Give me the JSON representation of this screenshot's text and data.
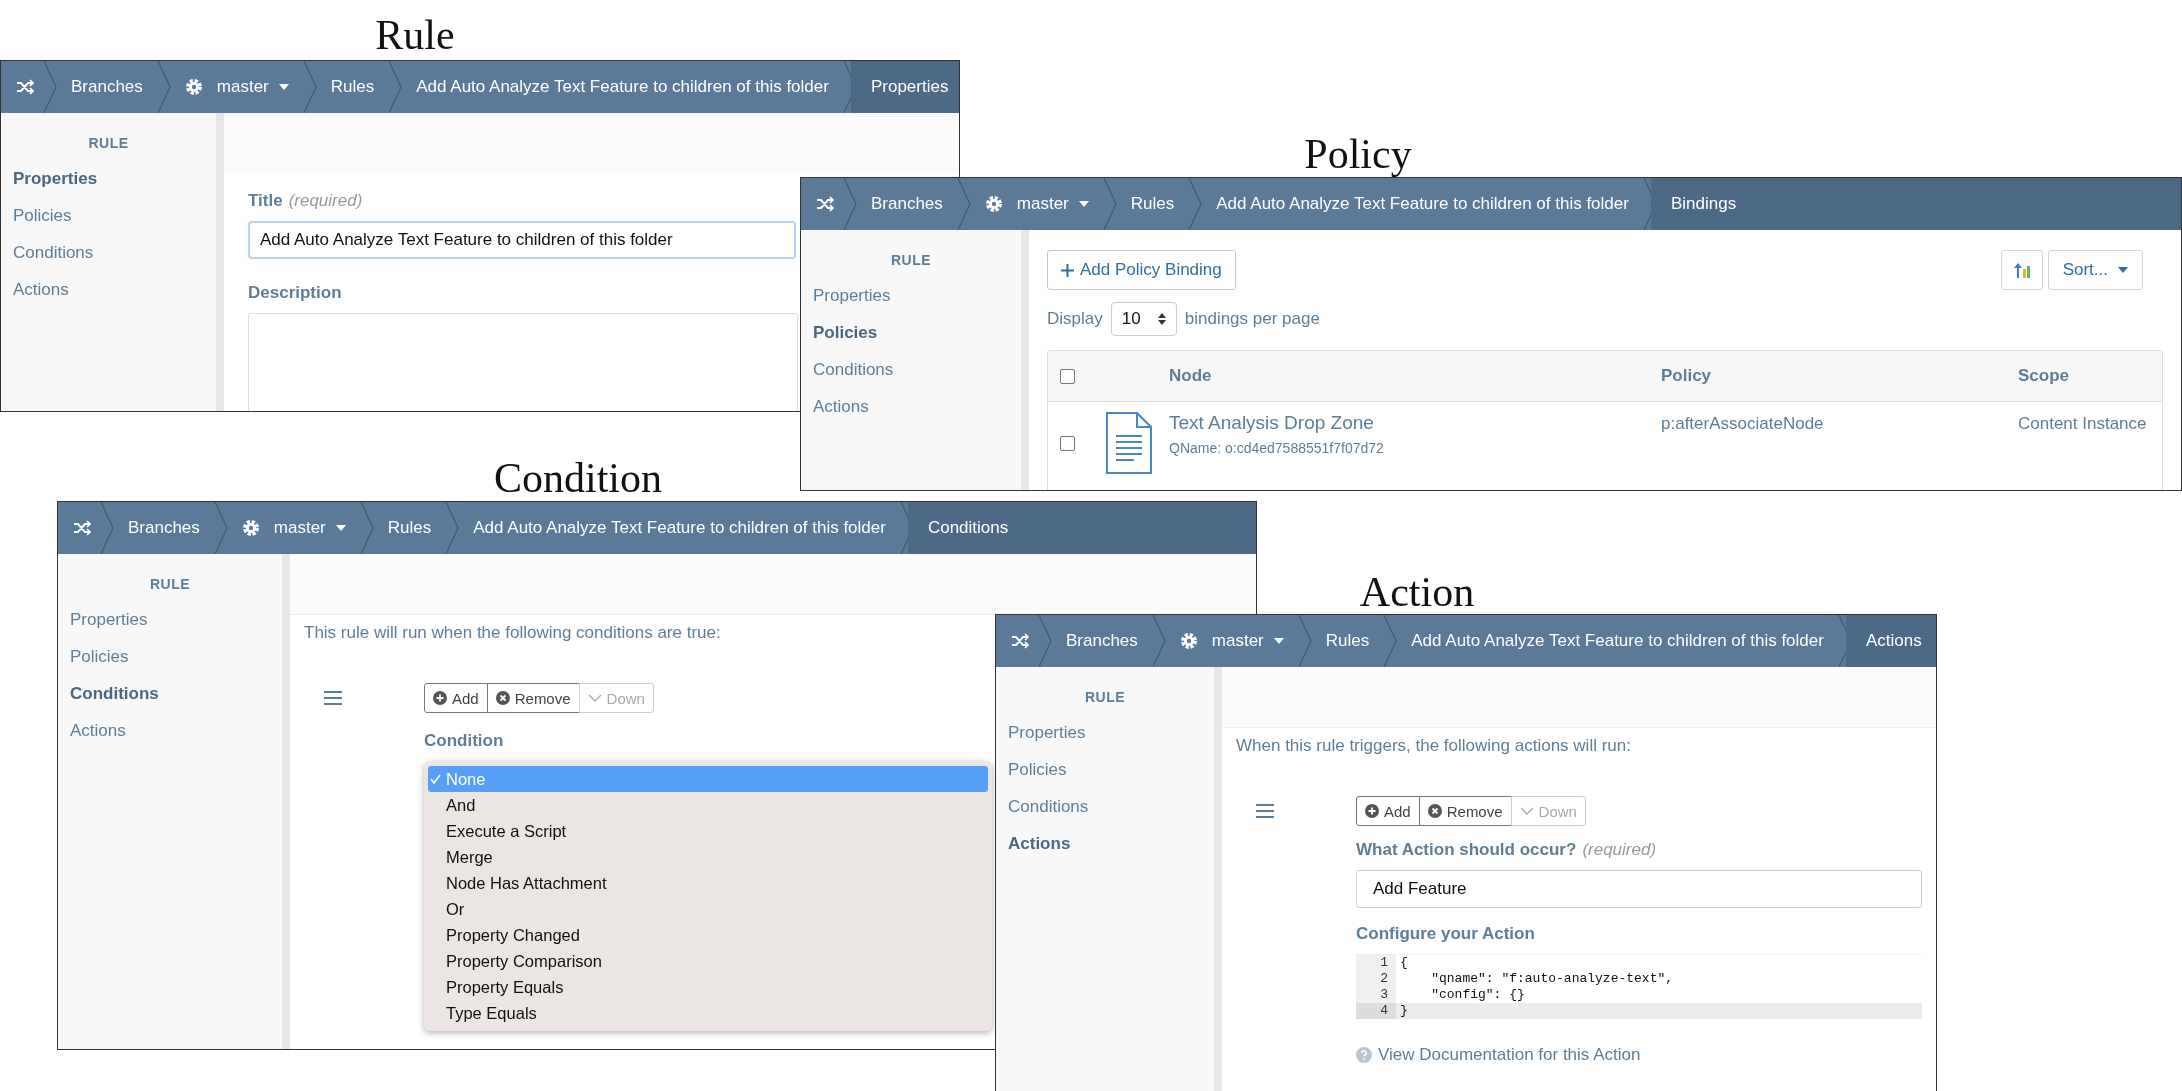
{
  "panels": [
    {
      "kind": "properties",
      "caption": "Rule",
      "breadcrumb": [
        {
          "kind": "home",
          "current": false
        },
        {
          "kind": "link",
          "label": "Branches",
          "current": false
        },
        {
          "kind": "branch",
          "label": "master",
          "current": false
        },
        {
          "kind": "link",
          "label": "Rules",
          "current": false
        },
        {
          "kind": "link",
          "label": "Add Auto Analyze Text Feature to children of this folder",
          "current": false
        },
        {
          "kind": "link",
          "label": "Properties",
          "current": true
        }
      ],
      "sidebar": {
        "heading": "RULE",
        "items": [
          {
            "label": "Properties",
            "selected": true
          },
          {
            "label": "Policies",
            "selected": false
          },
          {
            "label": "Conditions",
            "selected": false
          },
          {
            "label": "Actions",
            "selected": false
          }
        ]
      },
      "title_field": {
        "label": "Title",
        "hint": "(required)",
        "value": "Add Auto Analyze Text Feature to children of this folder"
      },
      "description_field": {
        "label": "Description"
      }
    },
    {
      "kind": "bindings",
      "caption": "Policy",
      "breadcrumb": [
        {
          "kind": "home",
          "current": false
        },
        {
          "kind": "link",
          "label": "Branches",
          "current": false
        },
        {
          "kind": "branch",
          "label": "master",
          "current": false
        },
        {
          "kind": "link",
          "label": "Rules",
          "current": false
        },
        {
          "kind": "link",
          "label": "Add Auto Analyze Text Feature to children of this folder",
          "current": false
        },
        {
          "kind": "link",
          "label": "Bindings",
          "current": true
        }
      ],
      "sidebar": {
        "heading": "RULE",
        "items": [
          {
            "label": "Properties",
            "selected": false
          },
          {
            "label": "Policies",
            "selected": true
          },
          {
            "label": "Conditions",
            "selected": false
          },
          {
            "label": "Actions",
            "selected": false
          }
        ]
      },
      "add_button": "Add Policy Binding",
      "sort_button": "Sort...",
      "page_size": {
        "before": "Display",
        "value": "10",
        "after": "bindings per page"
      },
      "table": {
        "columns": [
          "Node",
          "Policy",
          "Scope"
        ],
        "all_checked": false,
        "rows": [
          {
            "checked": false,
            "node": "Text Analysis Drop Zone",
            "qname": "QName: o:cd4ed7588551f7f07d72",
            "policy": "p:afterAssociateNode",
            "scope": "Content Instance"
          }
        ]
      }
    },
    {
      "kind": "conditions",
      "caption": "Condition",
      "breadcrumb": [
        {
          "kind": "home",
          "current": false
        },
        {
          "kind": "link",
          "label": "Branches",
          "current": false
        },
        {
          "kind": "branch",
          "label": "master",
          "current": false
        },
        {
          "kind": "link",
          "label": "Rules",
          "current": false
        },
        {
          "kind": "link",
          "label": "Add Auto Analyze Text Feature to children of this folder",
          "current": false
        },
        {
          "kind": "link",
          "label": "Conditions",
          "current": true
        }
      ],
      "sidebar": {
        "heading": "RULE",
        "items": [
          {
            "label": "Properties",
            "selected": false
          },
          {
            "label": "Policies",
            "selected": false
          },
          {
            "label": "Conditions",
            "selected": true
          },
          {
            "label": "Actions",
            "selected": false
          }
        ]
      },
      "intro": "This rule will run when the following conditions are true:",
      "toolbar": [
        {
          "kind": "add",
          "label": "Add",
          "disabled": false
        },
        {
          "kind": "remove",
          "label": "Remove",
          "disabled": false
        },
        {
          "kind": "down",
          "label": "Down",
          "disabled": true
        }
      ],
      "field_label": "Condition",
      "options": [
        {
          "label": "None",
          "selected": true
        },
        {
          "label": "And",
          "selected": false
        },
        {
          "label": "Execute a Script",
          "selected": false
        },
        {
          "label": "Merge",
          "selected": false
        },
        {
          "label": "Node Has Attachment",
          "selected": false
        },
        {
          "label": "Or",
          "selected": false
        },
        {
          "label": "Property Changed",
          "selected": false
        },
        {
          "label": "Property Comparison",
          "selected": false
        },
        {
          "label": "Property Equals",
          "selected": false
        },
        {
          "label": "Type Equals",
          "selected": false
        }
      ]
    },
    {
      "kind": "actions",
      "caption": "Action",
      "breadcrumb": [
        {
          "kind": "home",
          "current": false
        },
        {
          "kind": "link",
          "label": "Branches",
          "current": false
        },
        {
          "kind": "branch",
          "label": "master",
          "current": false
        },
        {
          "kind": "link",
          "label": "Rules",
          "current": false
        },
        {
          "kind": "link",
          "label": "Add Auto Analyze Text Feature to children of this folder",
          "current": false
        },
        {
          "kind": "link",
          "label": "Actions",
          "current": true
        }
      ],
      "sidebar": {
        "heading": "RULE",
        "items": [
          {
            "label": "Properties",
            "selected": false
          },
          {
            "label": "Policies",
            "selected": false
          },
          {
            "label": "Conditions",
            "selected": false
          },
          {
            "label": "Actions",
            "selected": true
          }
        ]
      },
      "intro": "When this rule triggers, the following actions will run:",
      "toolbar": [
        {
          "kind": "add",
          "label": "Add",
          "disabled": false
        },
        {
          "kind": "remove",
          "label": "Remove",
          "disabled": false
        },
        {
          "kind": "down",
          "label": "Down",
          "disabled": true
        }
      ],
      "action_field": {
        "label": "What Action should occur?",
        "hint": "(required)",
        "value": "Add Feature"
      },
      "config_label": "Configure your Action",
      "code": [
        {
          "number": "1",
          "text": "{",
          "active": false
        },
        {
          "number": "2",
          "text": "    \"qname\": \"f:auto-analyze-text\",",
          "active": false
        },
        {
          "number": "3",
          "text": "    \"config\": {}",
          "active": false
        },
        {
          "number": "4",
          "text": "}",
          "active": true
        }
      ],
      "doc_link": "View Documentation for this Action"
    }
  ]
}
